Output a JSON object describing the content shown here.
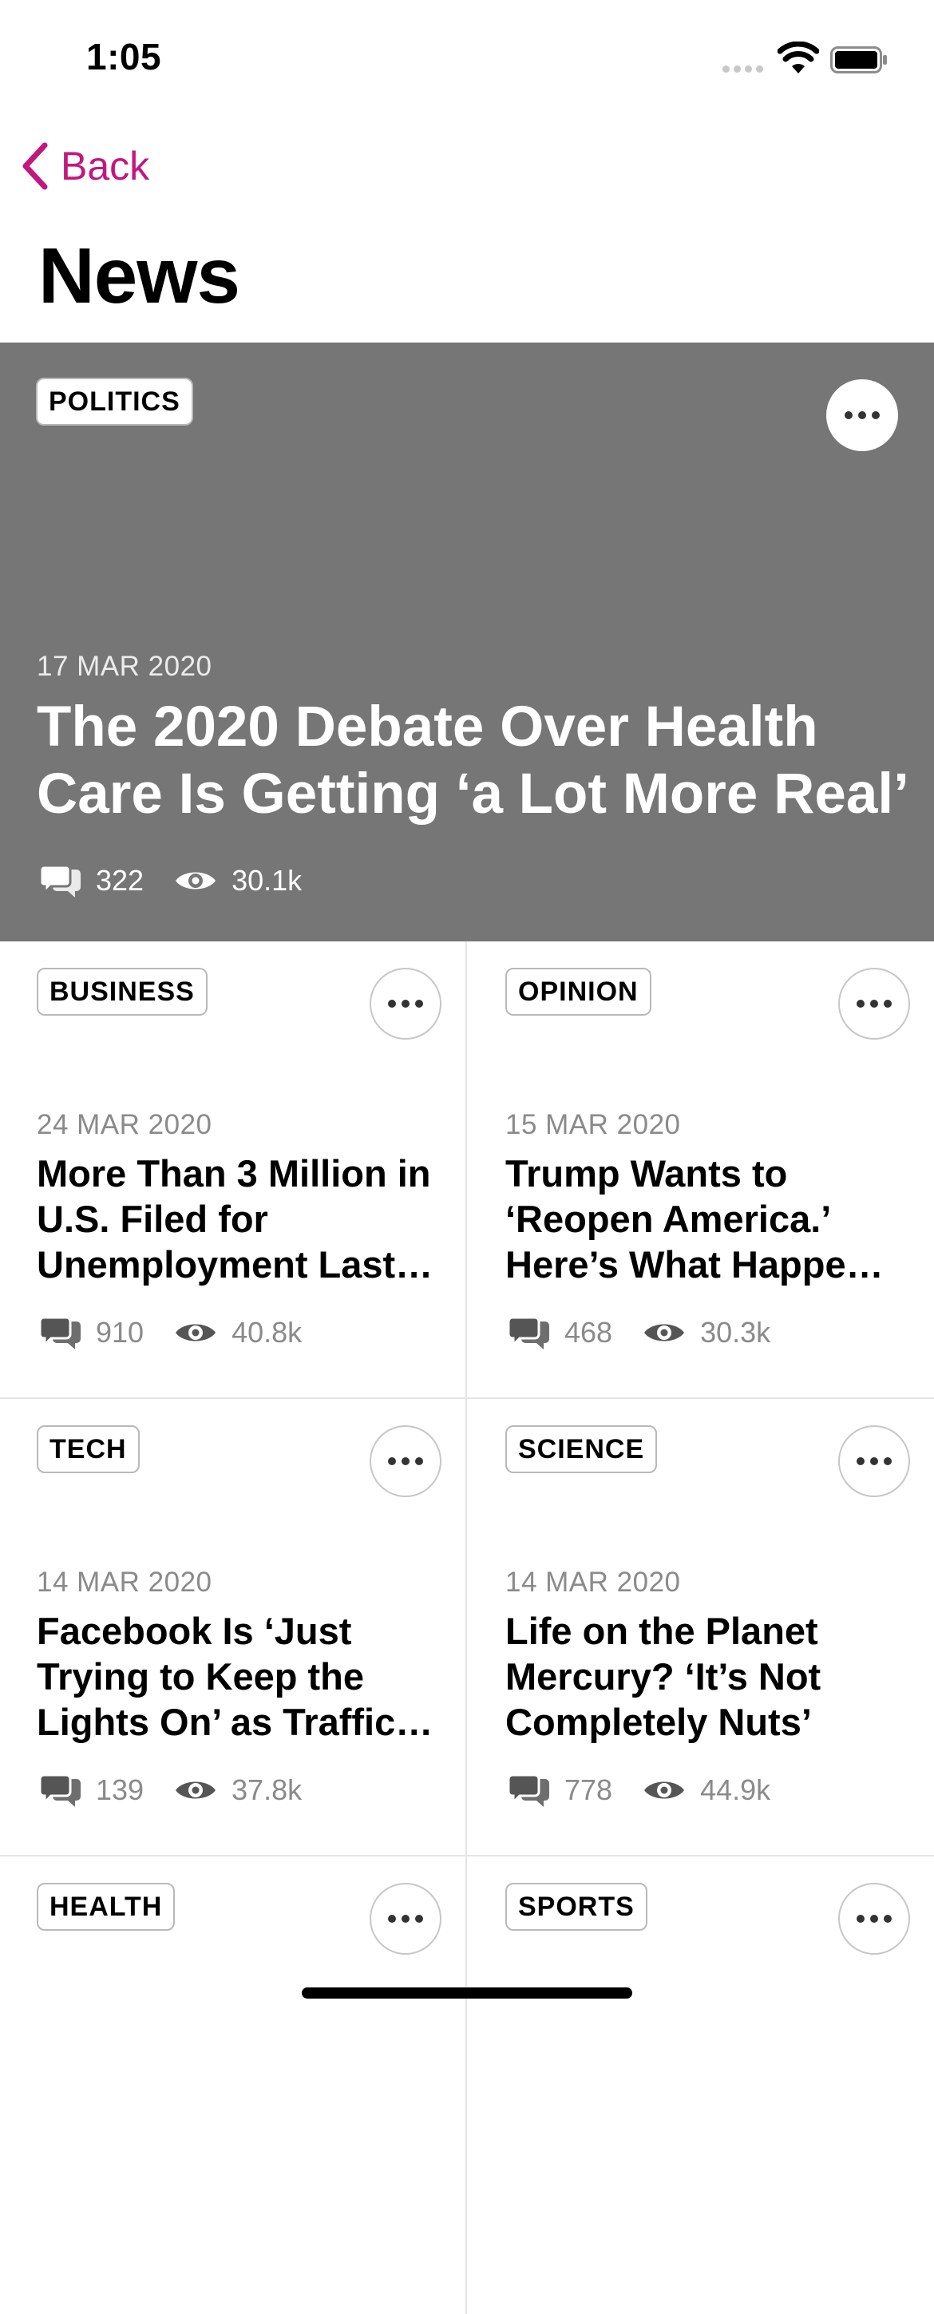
{
  "status_bar": {
    "time": "1:05"
  },
  "nav": {
    "back_label": "Back"
  },
  "page_title": "News",
  "featured": {
    "category": "POLITICS",
    "date": "17 MAR 2020",
    "title": "The 2020 Debate Over Health Care Is Getting ‘a Lot More Real’",
    "comments": "322",
    "views": "30.1k"
  },
  "articles": [
    {
      "category": "BUSINESS",
      "date": "24 MAR 2020",
      "title": "More Than 3 Million in U.S. Filed for Unemployment Last…",
      "comments": "910",
      "views": "40.8k"
    },
    {
      "category": "OPINION",
      "date": "15 MAR 2020",
      "title": "Trump Wants to ‘Reopen America.’ Here’s What Happe…",
      "comments": "468",
      "views": "30.3k"
    },
    {
      "category": "TECH",
      "date": "14 MAR 2020",
      "title": "Facebook Is ‘Just Trying to Keep the Lights On’ as Traffic…",
      "comments": "139",
      "views": "37.8k"
    },
    {
      "category": "SCIENCE",
      "date": "14 MAR 2020",
      "title": "Life on the Planet Mercury? ‘It’s Not Completely Nuts’",
      "comments": "778",
      "views": "44.9k"
    },
    {
      "category": "HEALTH"
    },
    {
      "category": "SPORTS"
    }
  ],
  "colors": {
    "accent": "#c2187d",
    "featured_bg": "#767676",
    "meta_gray": "#8a8a8a"
  },
  "icons": {
    "back": "chevron-left-icon",
    "more": "more-horizontal-icon",
    "comments": "comments-icon",
    "views": "eye-icon"
  }
}
